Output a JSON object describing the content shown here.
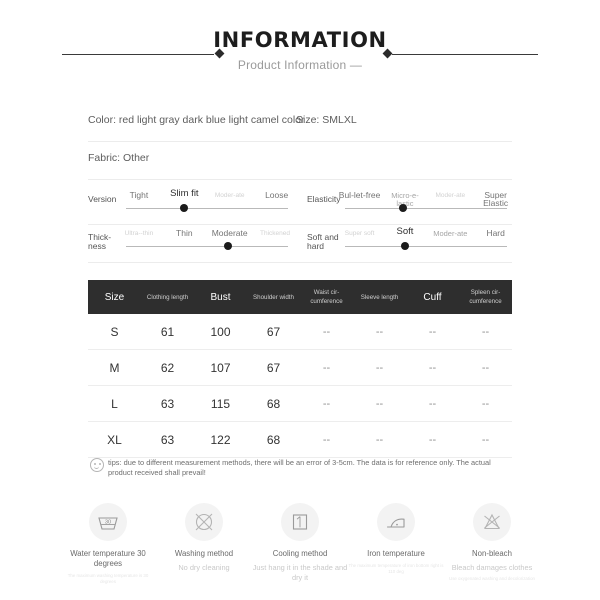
{
  "header": {
    "title": "INFORMATION",
    "subtitle": "Product Information —"
  },
  "info": {
    "color": "Color: red light gray dark blue light camel color",
    "size": "Size: SMLXL",
    "fabric": "Fabric: Other"
  },
  "attributes": [
    {
      "name": "Version",
      "ticks": [
        "Tight",
        "Slim fit",
        "Moder-ate",
        "Loose"
      ],
      "selected_index": 1,
      "selected_percent": 36
    },
    {
      "name": "Elasticity",
      "ticks": [
        "Bul-let-free",
        "Micro-e-lastic",
        "Moder-ate",
        "Super Elastic"
      ],
      "selected_index": 1,
      "selected_percent": 36
    },
    {
      "name": "Thick-ness",
      "ticks": [
        "Ultra--thin",
        "Thin",
        "Moderate",
        "Thickened"
      ],
      "selected_index": 2,
      "selected_percent": 63
    },
    {
      "name": "Soft and hard",
      "ticks": [
        "Super soft",
        "Soft",
        "Moder-ate",
        "Hard"
      ],
      "selected_index": 1,
      "selected_percent": 37
    }
  ],
  "size_table": {
    "headers": [
      "Size",
      "Clothing length",
      "Bust",
      "Shoulder width",
      "Waist cir-cumference",
      "Sleeve length",
      "Cuff",
      "Spleen cir-cumference"
    ],
    "rows": [
      [
        "S",
        "61",
        "100",
        "67",
        "--",
        "--",
        "--",
        "--"
      ],
      [
        "M",
        "62",
        "107",
        "67",
        "--",
        "--",
        "--",
        "--"
      ],
      [
        "L",
        "63",
        "115",
        "68",
        "--",
        "--",
        "--",
        "--"
      ],
      [
        "XL",
        "63",
        "122",
        "68",
        "--",
        "--",
        "--",
        "--"
      ]
    ]
  },
  "tips": {
    "text": "tips: due to different measurement methods, there will be an error of 3-5cm. The data is for reference only. The actual product received shall prevail!"
  },
  "care_instructions": [
    {
      "icon": "wash-tub-30-icon",
      "title": "Water temperature 30 degrees",
      "sub": "",
      "faint": "The maximum washing temperature is 30 degrees"
    },
    {
      "icon": "no-dry-clean-icon",
      "title": "Washing method",
      "sub": "No dry cleaning",
      "faint": ""
    },
    {
      "icon": "hang-dry-icon",
      "title": "Cooling method",
      "sub": "Just hang it in the shade and dry it",
      "faint": ""
    },
    {
      "icon": "iron-icon",
      "title": "Iron temperature",
      "sub": "",
      "faint": "The maximum temperature of iron bottom right is 110 deg"
    },
    {
      "icon": "no-bleach-icon",
      "title": "Non-bleach",
      "sub": "Bleach damages clothes",
      "faint": "Use oxygenated washing and decolorization"
    }
  ],
  "colors": {
    "table_header_bg": "#2e2e2e",
    "accent_dark": "#1b1b1b",
    "divider": "#ececec",
    "badge_bg": "#f3f3f3"
  }
}
